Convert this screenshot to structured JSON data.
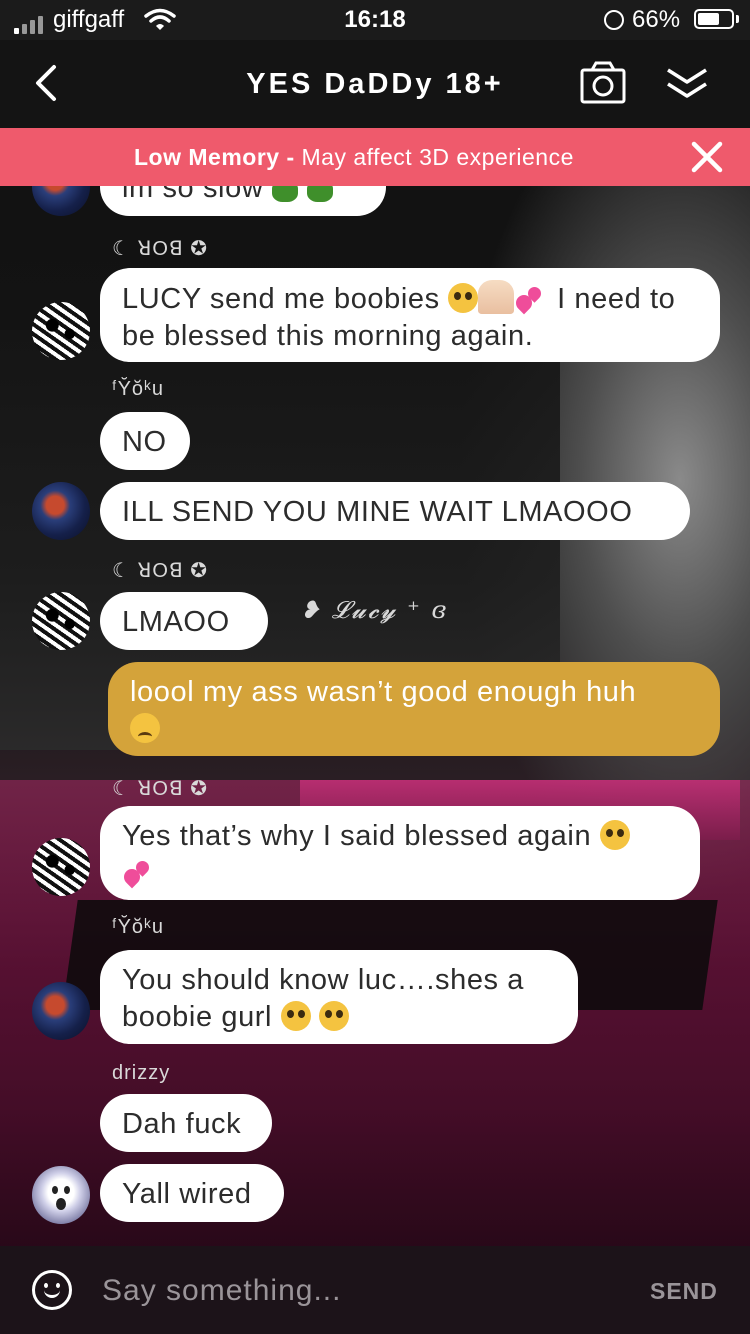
{
  "status_bar": {
    "carrier": "giffgaff",
    "time": "16:18",
    "battery_percent": "66%",
    "battery_level": 0.66
  },
  "header": {
    "title": "YES DaDDy 18+"
  },
  "banner": {
    "bold": "Low Memory -",
    "text": " May affect 3D experience"
  },
  "scene": {
    "nametag": "❥ 𝓛𝓾𝓬𝔂 ⁺ ɞ"
  },
  "chat": {
    "messages": [
      {
        "text": "im so slow"
      },
      {
        "sender": "☾ ꓤOꓭ ✪",
        "text_a": "LUCY send me boobies",
        "text_b": " I need to be blessed this morning again."
      },
      {
        "sender": "ᶠY̆ŏᵏu",
        "text": "NO"
      },
      {
        "text": "ILL SEND YOU MINE WAIT LMAOOO"
      },
      {
        "sender": "☾ ꓤOꓭ ✪",
        "text": "LMAOO"
      },
      {
        "text": "loool my ass wasn’t good enough huh"
      },
      {
        "sender": "☾ ꓤOꓭ ✪",
        "text": "Yes that’s why I said blessed again"
      },
      {
        "sender": "ᶠY̆ŏᵏu",
        "text": "You should know luc….shes a boobie gurl"
      },
      {
        "sender": "drizzy",
        "text": "Dah fuck"
      },
      {
        "text": "Yall wired"
      }
    ]
  },
  "input": {
    "placeholder": "Say something...",
    "send_label": "SEND"
  },
  "colors": {
    "banner": "#ef5a6c",
    "my_bubble": "#d4a33a",
    "bubble": "#ffffff"
  },
  "icons": [
    "back-chevron-icon",
    "camera-icon",
    "collapse-chevrons-icon",
    "close-icon",
    "emoji-smiley-icon",
    "wifi-icon",
    "lock-rotation-icon",
    "battery-icon",
    "signal-icon"
  ]
}
